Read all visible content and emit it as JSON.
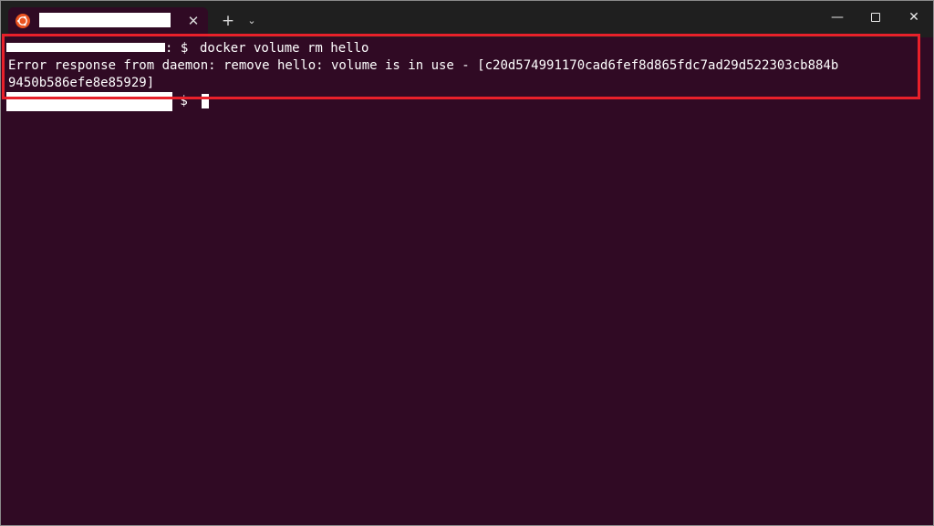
{
  "window": {
    "tab_title": "",
    "tab_close_glyph": "✕",
    "new_tab_glyph": "+",
    "tab_dropdown_glyph": "⌄",
    "minimize_glyph": "—",
    "close_glyph": "✕",
    "app_icon": "ubuntu-icon",
    "colors": {
      "titlebar": "#1f1f1f",
      "terminal_background": "#300a24",
      "ubuntu_orange": "#e95420",
      "annotation_red": "#e8202a"
    }
  },
  "terminal": {
    "lines": [
      {
        "prompt_suffix": ": $ ",
        "command": "docker volume rm hello"
      },
      {
        "text": "Error response from daemon: remove hello: volume is in use - [c20d574991170cad6fef8d865fdc7ad29d522303cb884b"
      },
      {
        "text": "9450b586efe8e85929]"
      },
      {
        "prompt_suffix": " $ ",
        "command": ""
      }
    ]
  }
}
